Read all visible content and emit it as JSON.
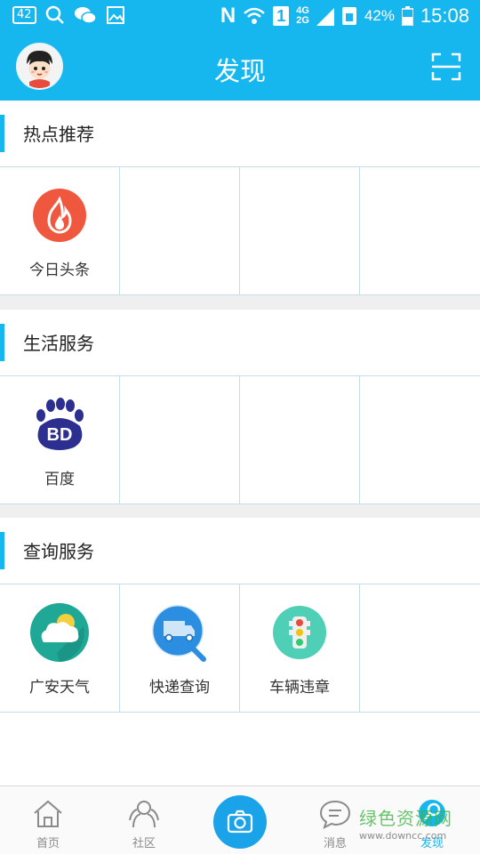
{
  "status_bar": {
    "badge": "42",
    "carrier_mark": "N",
    "sim_slot": "1",
    "net_top": "4G",
    "net_bottom": "2G",
    "battery": "42%",
    "time": "15:08"
  },
  "header": {
    "title": "发现",
    "avatar_icon": "cartoon-avatar-icon",
    "scan_icon": "scan-frame-icon"
  },
  "sections": [
    {
      "title": "热点推荐",
      "items": [
        {
          "label": "今日头条",
          "icon": "fire-icon",
          "color": "#f0573f"
        }
      ]
    },
    {
      "title": "生活服务",
      "items": [
        {
          "label": "百度",
          "icon": "baidu-paw-icon",
          "color": "#2c2f8f"
        }
      ]
    },
    {
      "title": "查询服务",
      "items": [
        {
          "label": "广安天气",
          "icon": "weather-cloud-icon",
          "color": "#1fa896"
        },
        {
          "label": "快递查询",
          "icon": "delivery-truck-icon",
          "color": "#2c8ee0"
        },
        {
          "label": "车辆违章",
          "icon": "traffic-light-icon",
          "color": "#4fcfb6"
        }
      ]
    }
  ],
  "bottom_nav": {
    "items": [
      {
        "label": "首页",
        "icon": "home-icon"
      },
      {
        "label": "社区",
        "icon": "community-icon"
      },
      {
        "label": "",
        "icon": "camera-icon"
      },
      {
        "label": "消息",
        "icon": "message-icon"
      },
      {
        "label": "发现",
        "icon": "discover-icon"
      }
    ]
  },
  "watermark": {
    "line1": "绿色资源网",
    "line2": "www.downcc.com"
  },
  "colors": {
    "primary": "#16b6ef",
    "divider": "#c9dde8",
    "gap": "#efefef"
  }
}
